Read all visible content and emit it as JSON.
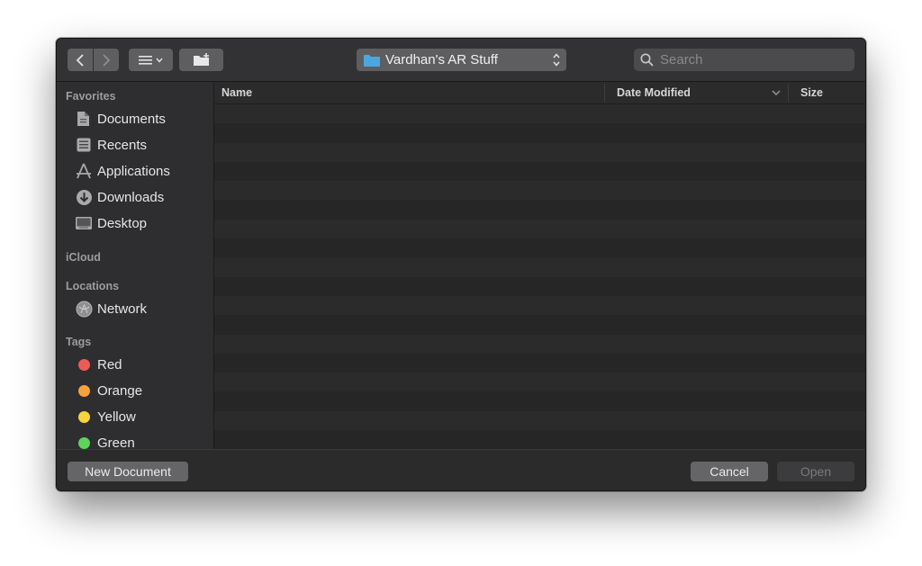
{
  "toolbar": {
    "back_icon": "chevron-left-icon",
    "forward_icon": "chevron-right-icon",
    "view_icon": "list-view-icon",
    "new_folder_icon": "new-folder-icon",
    "location": "Vardhan's AR Stuff",
    "search_placeholder": "Search"
  },
  "sidebar": {
    "favorites_title": "Favorites",
    "favorites": [
      {
        "label": "Documents",
        "icon": "document-icon"
      },
      {
        "label": "Recents",
        "icon": "recents-icon"
      },
      {
        "label": "Applications",
        "icon": "applications-icon"
      },
      {
        "label": "Downloads",
        "icon": "downloads-icon"
      },
      {
        "label": "Desktop",
        "icon": "desktop-icon"
      }
    ],
    "icloud_title": "iCloud",
    "locations_title": "Locations",
    "locations": [
      {
        "label": "Network",
        "icon": "network-icon"
      }
    ],
    "tags_title": "Tags",
    "tags": [
      {
        "label": "Red",
        "color": "#ee5b57"
      },
      {
        "label": "Orange",
        "color": "#f5a33a"
      },
      {
        "label": "Yellow",
        "color": "#f7d53b"
      },
      {
        "label": "Green",
        "color": "#5ed35a"
      }
    ]
  },
  "list": {
    "columns": [
      "Name",
      "Date Modified",
      "Size"
    ],
    "rows": []
  },
  "footer": {
    "new_document": "New Document",
    "cancel": "Cancel",
    "open": "Open"
  },
  "colors": {
    "window": "#2b2b2c",
    "folder": "#4aa8df"
  }
}
